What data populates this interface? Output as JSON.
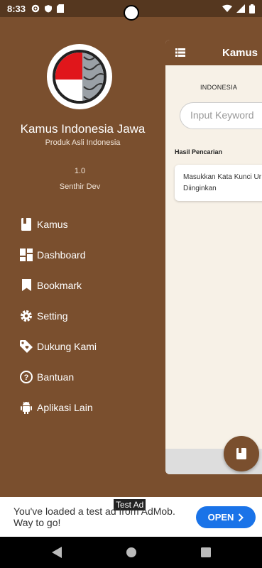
{
  "status": {
    "time": "8:33"
  },
  "app": {
    "title": "Kamus",
    "language_label": "INDONESIA",
    "search_placeholder": "Input Keyword",
    "results_heading": "Hasil Pencarian",
    "results_hint_line1": "Masukkan Kata Kunci Ur",
    "results_hint_line2": "Diinginkan"
  },
  "drawer": {
    "app_name": "Kamus Indonesia Jawa",
    "tagline": "Produk Asli Indonesia",
    "version": "1.0",
    "developer": "Senthir Dev",
    "items": [
      {
        "label": "Kamus",
        "icon": "book-icon"
      },
      {
        "label": "Dashboard",
        "icon": "dashboard-icon"
      },
      {
        "label": "Bookmark",
        "icon": "bookmark-icon"
      },
      {
        "label": "Setting",
        "icon": "gear-icon"
      },
      {
        "label": "Dukung Kami",
        "icon": "tag-icon"
      },
      {
        "label": "Bantuan",
        "icon": "help-icon"
      },
      {
        "label": "Aplikasi Lain",
        "icon": "android-icon"
      }
    ]
  },
  "ad": {
    "label": "Test Ad",
    "text": "You've loaded a test ad from AdMob. Way to go!",
    "button": "OPEN"
  },
  "colors": {
    "brown": "#7a4f2e",
    "ad_blue": "#1a73e8"
  }
}
